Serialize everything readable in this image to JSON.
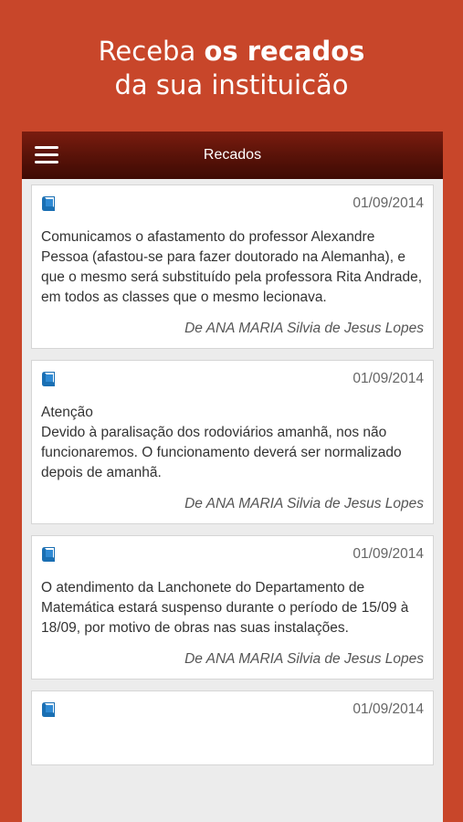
{
  "promo": {
    "line1_normal": "Receba",
    "line1_bold": "os recados",
    "line2": "da sua instituicão"
  },
  "navbar": {
    "title": "Recados",
    "menu_icon": "hamburger-menu-icon"
  },
  "messages": [
    {
      "icon": "book-icon",
      "date": "01/09/2014",
      "text": "Comunicamos o afastamento do professor Alexandre Pessoa (afastou-se para fazer doutorado na Alemanha), e que o mesmo será substituído pela professora Rita Andrade, em todos as classes que o mesmo lecionava.",
      "author": "De ANA MARIA Silvia de Jesus Lopes"
    },
    {
      "icon": "book-icon",
      "date": "01/09/2014",
      "text": "Atenção\nDevido à paralisação dos rodoviários amanhã, nos não funcionaremos. O funcionamento deverá ser normalizado depois de amanhã.",
      "author": "De ANA MARIA Silvia de Jesus Lopes"
    },
    {
      "icon": "book-icon",
      "date": "01/09/2014",
      "text": "O atendimento da Lanchonete do Departamento de Matemática estará suspenso durante o período de 15/09 à 18/09, por motivo de obras nas suas instalações.",
      "author": "De ANA MARIA Silvia de Jesus Lopes"
    },
    {
      "icon": "book-icon",
      "date": "01/09/2014",
      "text": "",
      "author": ""
    }
  ]
}
